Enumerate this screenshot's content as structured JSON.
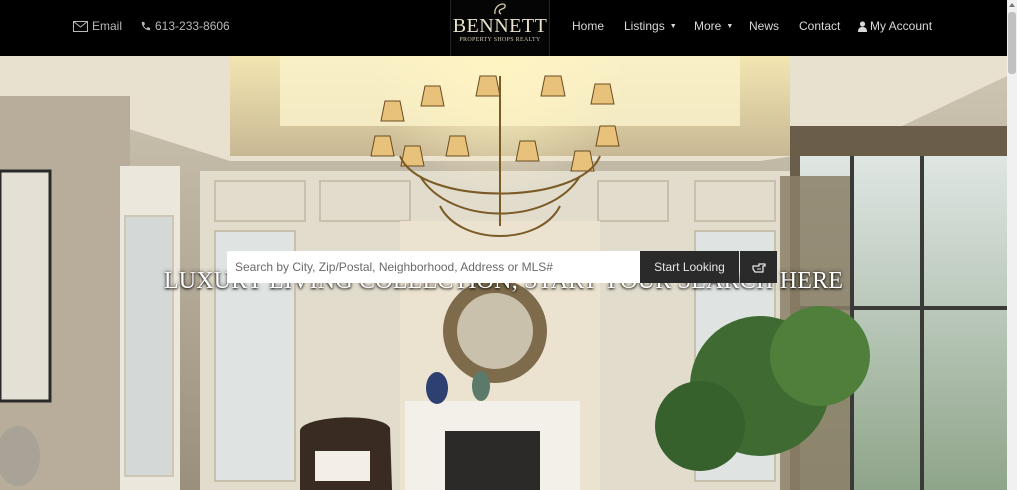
{
  "header": {
    "email_label": "Email",
    "phone_label": "613-233-8606",
    "logo": {
      "name": "BENNETT",
      "sub": "PROPERTY SHOPS REALTY"
    },
    "nav": [
      {
        "label": "Home",
        "dropdown": false
      },
      {
        "label": "Listings",
        "dropdown": true
      },
      {
        "label": "More",
        "dropdown": true
      },
      {
        "label": "News",
        "dropdown": false
      },
      {
        "label": "Contact",
        "dropdown": false
      }
    ],
    "account_label": "My Account"
  },
  "hero": {
    "headline": "LUXURY LIVING COLLECTION, START YOUR SEARCH HERE",
    "search": {
      "placeholder": "Search by City, Zip/Postal, Neighborhood, Address or MLS#",
      "value": "",
      "button_label": "Start Looking"
    }
  },
  "colors": {
    "nav_bg": "#000000",
    "button_bg": "#2a2a2a",
    "nav_text": "#d8d8d8"
  },
  "icons": {
    "email": "envelope-icon",
    "phone": "phone-icon",
    "account": "user-icon",
    "go": "pointing-hand-icon"
  }
}
